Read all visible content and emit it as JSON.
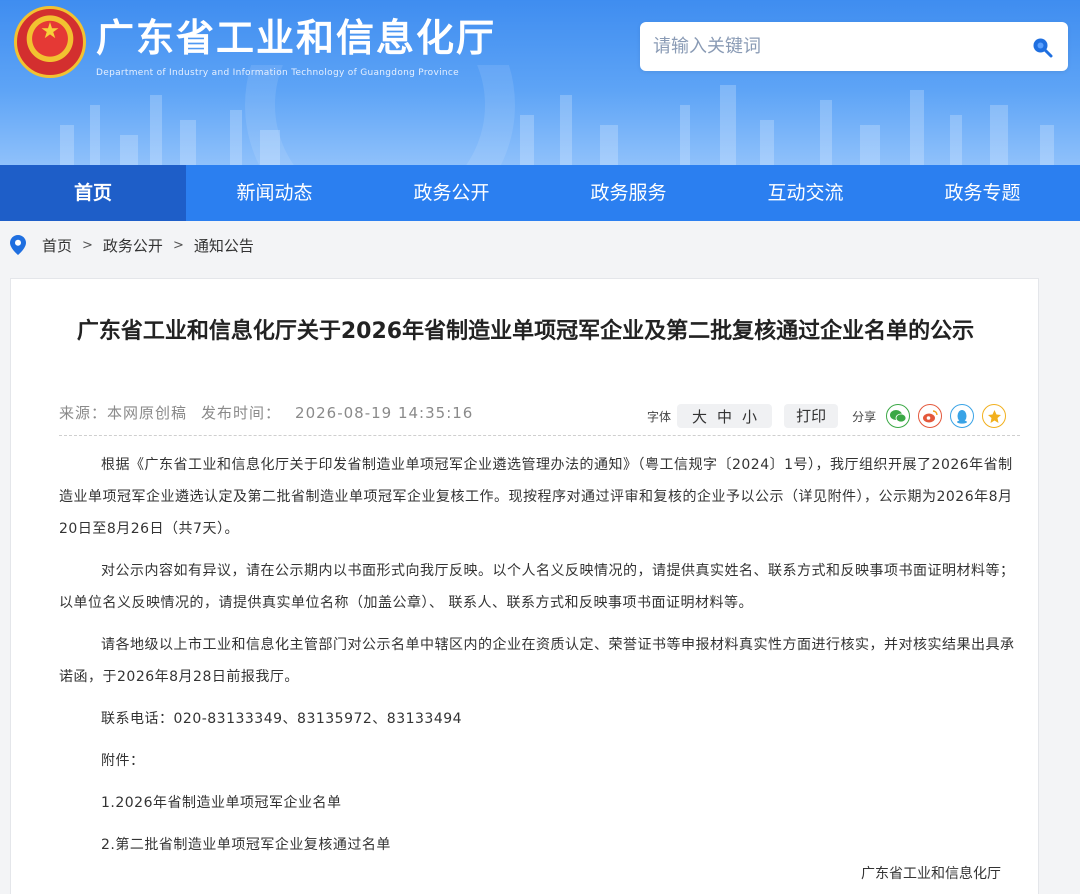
{
  "header": {
    "title": "广东省工业和信息化厅",
    "subtitle": "Department of Industry and Information Technology of Guangdong Province",
    "search_placeholder": "请输入关键词",
    "icons": {
      "emblem": "national-emblem",
      "search": "search-icon"
    }
  },
  "nav": {
    "items": [
      {
        "label": "首页",
        "active": true
      },
      {
        "label": "新闻动态"
      },
      {
        "label": "政务公开"
      },
      {
        "label": "政务服务"
      },
      {
        "label": "互动交流"
      },
      {
        "label": "政务专题"
      }
    ]
  },
  "breadcrumb": {
    "items": [
      "首页",
      "政务公开",
      "通知公告"
    ],
    "separator": ">"
  },
  "article": {
    "title": "广东省工业和信息化厅关于2026年省制造业单项冠军企业及第二批复核通过企业名单的公示",
    "source": "来源：本网原创稿",
    "publish_label": "发布时间：",
    "publish_time": "2026-08-19 14:35:16",
    "font_label": "字体",
    "font_sizes": [
      "大",
      "中",
      "小"
    ],
    "print_label": "打印",
    "share_label": "分享",
    "share_icons": [
      "wechat-icon",
      "weibo-icon",
      "qq-icon",
      "qzone-icon"
    ],
    "paragraphs": [
      "根据《广东省工业和信息化厅关于印发省制造业单项冠军企业遴选管理办法的通知》（粤工信规字〔2024〕1号），我厅组织开展了2026年省制造业单项冠军企业遴选认定及第二批省制造业单项冠军企业复核工作。现按程序对通过评审和复核的企业予以公示（详见附件），公示期为2026年8月20日至8月26日（共7天）。",
      "对公示内容如有异议，请在公示期内以书面形式向我厅反映。以个人名义反映情况的，请提供真实姓名、联系方式和反映事项书面证明材料等；以单位名义反映情况的，请提供真实单位名称（加盖公章）、 联系人、联系方式和反映事项书面证明材料等。",
      "请各地级以上市工业和信息化主管部门对公示名单中辖区内的企业在资质认定、荣誉证书等申报材料真实性方面进行核实，并对核实结果出具承诺函，于2026年8月28日前报我厅。"
    ],
    "contact": "联系电话：020-83133349、83135972、83133494",
    "attachments_label": "附件：",
    "attachments": [
      "1.2026年省制造业单项冠军企业名单",
      "2.第二批省制造业单项冠军企业复核通过名单"
    ],
    "signature": "广东省工业和信息化厅"
  },
  "colors": {
    "nav_bg": "#2b7ff0",
    "nav_active": "#1e5ec8",
    "header_top": "#3f8df0",
    "search_icon": "#1f6fe0"
  }
}
